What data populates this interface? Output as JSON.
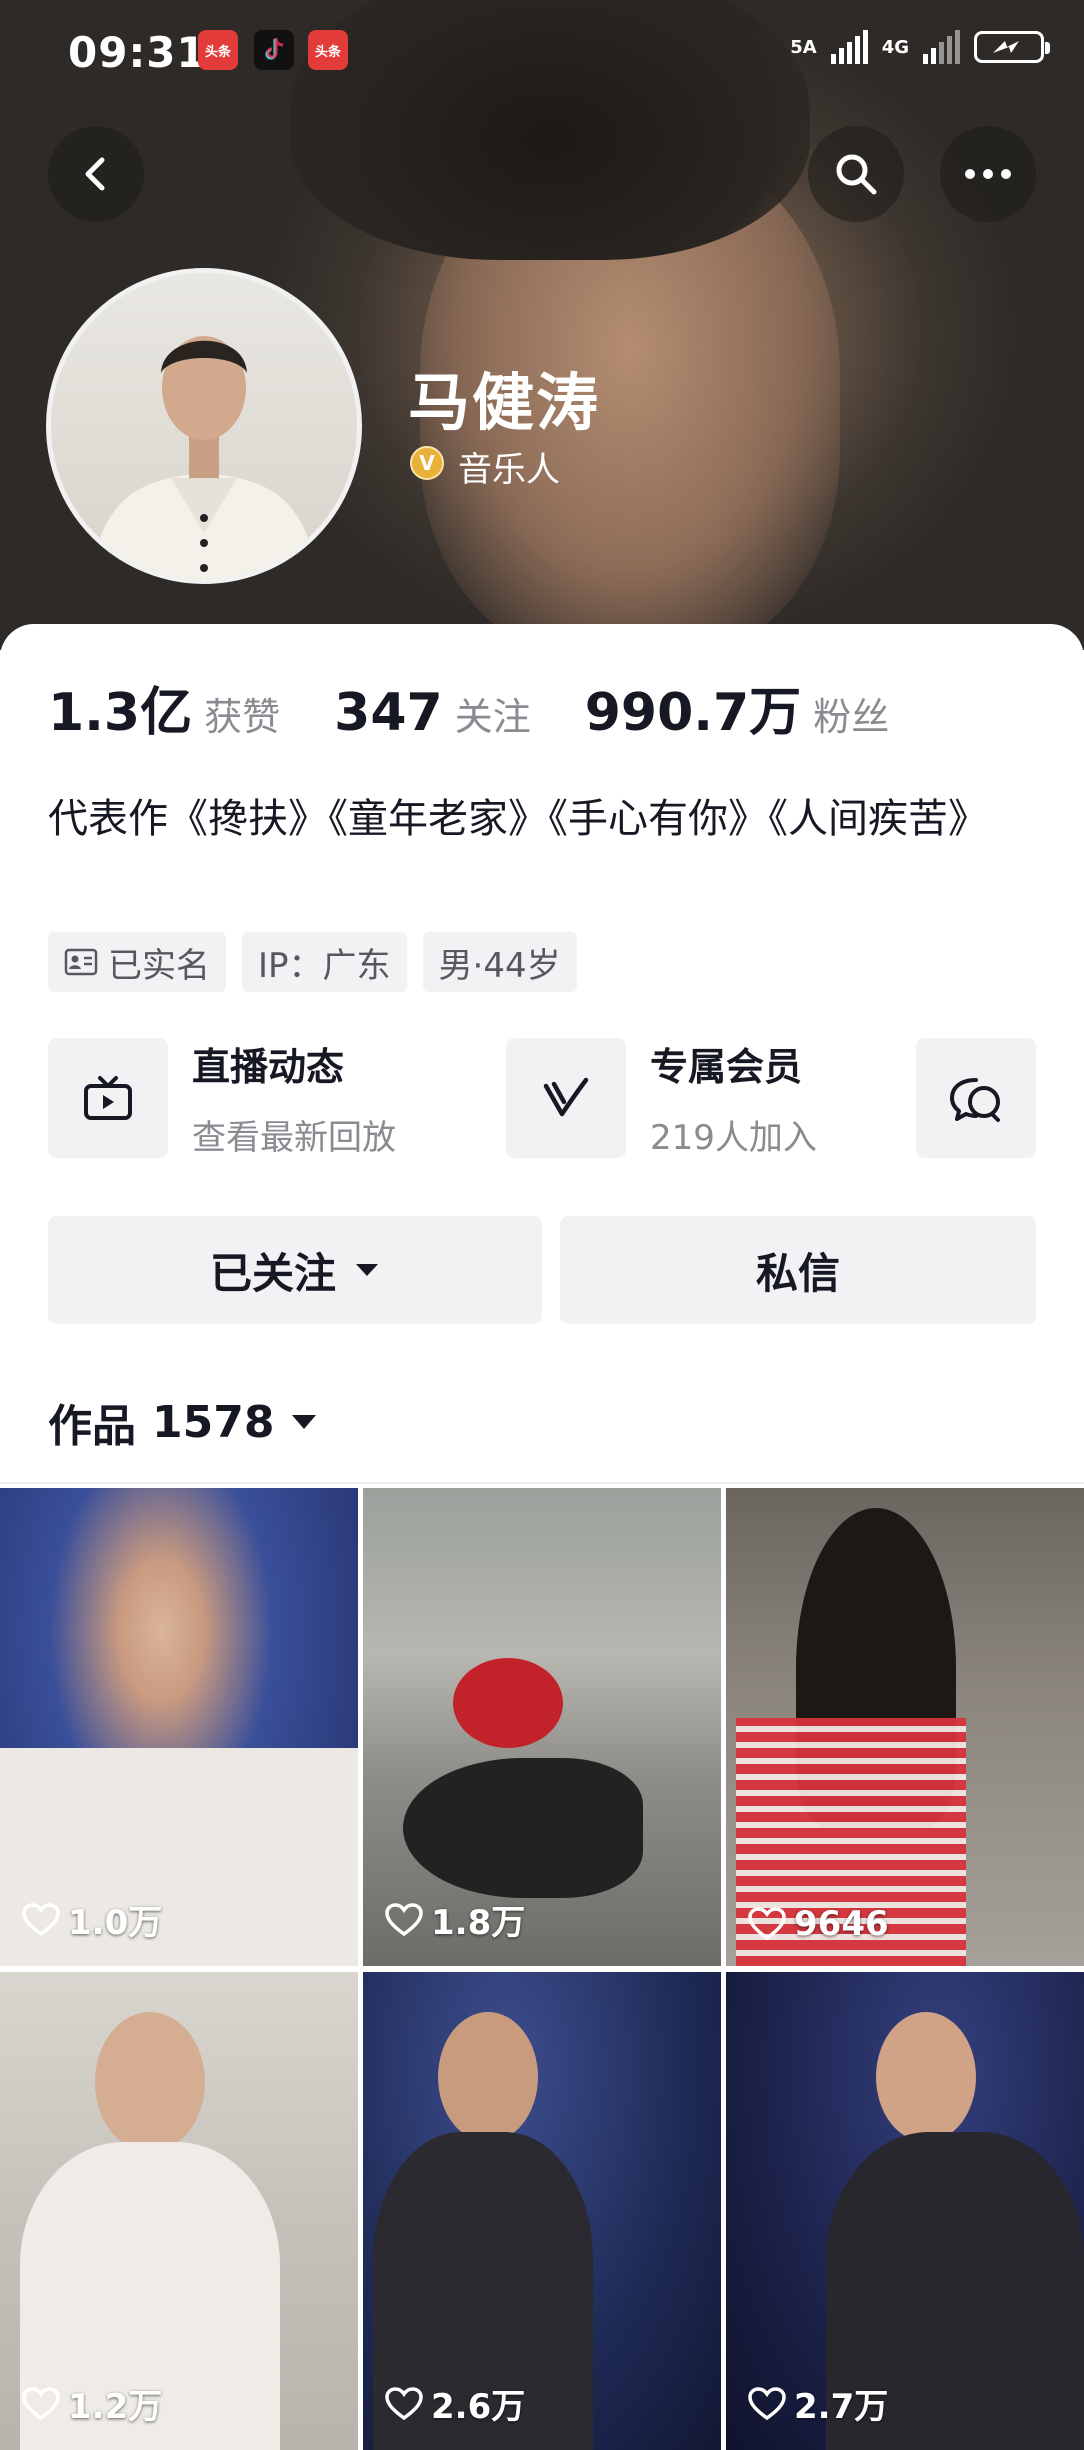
{
  "status_bar": {
    "time": "09:31",
    "net1": "5A",
    "net2": "4G",
    "apps": [
      "头条",
      "头条"
    ]
  },
  "profile": {
    "name": "马健涛",
    "role": "音乐人",
    "verify_glyph": "V"
  },
  "stats": [
    {
      "value": "1.3亿",
      "label": "获赞"
    },
    {
      "value": "347",
      "label": "关注"
    },
    {
      "value": "990.7万",
      "label": "粉丝"
    }
  ],
  "bio": "代表作《搀扶》《童年老家》《手心有你》《人间疾苦》",
  "tags": {
    "realname": "已实名",
    "ip": "IP：广东",
    "gender_age": "男·44岁"
  },
  "cards": {
    "live": {
      "title": "直播动态",
      "sub": "查看最新回放"
    },
    "member": {
      "title": "专属会员",
      "sub": "219人加入"
    }
  },
  "buttons": {
    "follow": "已关注",
    "message": "私信"
  },
  "works": {
    "label": "作品",
    "count": "1578"
  },
  "videos": [
    {
      "likes": "1.0万",
      "bg": "#2b3f7a"
    },
    {
      "likes": "1.8万",
      "bg": "#8a8b86"
    },
    {
      "likes": "9646",
      "bg": "#7d7670"
    },
    {
      "likes": "1.2万",
      "bg": "#c9c4bd"
    },
    {
      "likes": "2.6万",
      "bg": "#1e2a55"
    },
    {
      "likes": "2.7万",
      "bg": "#1b2148"
    }
  ],
  "icons": [
    "back-icon",
    "search-icon",
    "more-icon",
    "tv-icon",
    "v-member-icon",
    "chat-icon",
    "caret-down-icon",
    "heart-icon",
    "id-card-icon"
  ]
}
